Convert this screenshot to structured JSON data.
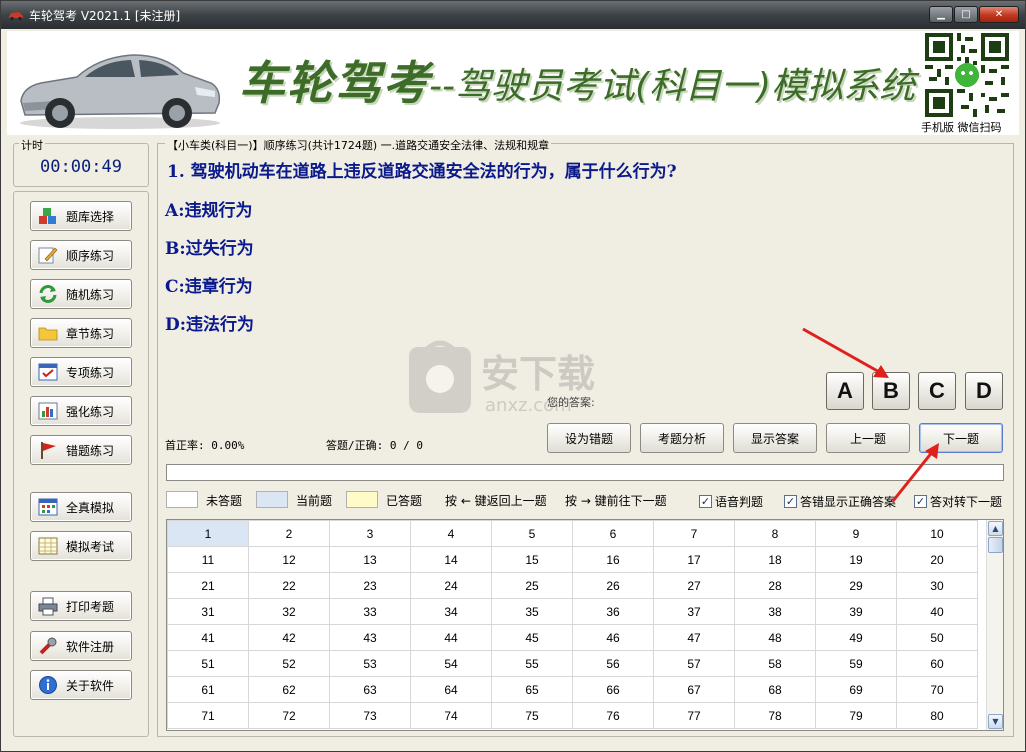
{
  "window": {
    "title": "车轮驾考 V2021.1 [未注册]",
    "controls": {
      "minimize": "▁",
      "maximize": "□",
      "close": "✕"
    }
  },
  "header": {
    "brand": "车轮驾考",
    "subtitle": "--驾驶员考试(科目一)模拟系统",
    "qr_caption": "手机版 微信扫码"
  },
  "timer": {
    "label": "计时",
    "value": "00:00:49"
  },
  "nav": {
    "items": [
      {
        "label": "题库选择",
        "icon": "cubes-icon"
      },
      {
        "label": "顺序练习",
        "icon": "pencil-note-icon"
      },
      {
        "label": "随机练习",
        "icon": "refresh-arrows-icon"
      },
      {
        "label": "章节练习",
        "icon": "folder-icon"
      },
      {
        "label": "专项练习",
        "icon": "checklist-icon"
      },
      {
        "label": "强化练习",
        "icon": "bar-chart-icon"
      },
      {
        "label": "错题练习",
        "icon": "red-flag-icon"
      },
      {
        "label": "全真模拟",
        "icon": "calendar-grid-icon"
      },
      {
        "label": "模拟考试",
        "icon": "table-icon"
      },
      {
        "label": "打印考题",
        "icon": "printer-icon"
      },
      {
        "label": "软件注册",
        "icon": "wrench-icon"
      },
      {
        "label": "关于软件",
        "icon": "info-icon"
      }
    ]
  },
  "exam": {
    "breadcrumb": "【小车类(科目一)】顺序练习(共计1724题) 一.道路交通安全法律、法规和规章",
    "question": "1. 驾驶机动车在道路上违反道路交通安全法的行为，属于什么行为?",
    "options": [
      "A:违规行为",
      "B:过失行为",
      "C:违章行为",
      "D:违法行为"
    ],
    "watermark": {
      "text": "安下载",
      "sub": "anxz.com"
    },
    "answer_label": "您的答案:",
    "answer_buttons": [
      "A",
      "B",
      "C",
      "D"
    ],
    "first_correct_rate": "首正率: 0.00%",
    "answered_correct": "答题/正确: 0 / 0",
    "actions": [
      "设为错题",
      "考题分析",
      "显示答案",
      "上一题",
      "下一题"
    ]
  },
  "legend": {
    "unanswered": "未答题",
    "current": "当前题",
    "answered": "已答题",
    "hint_prev": "按 ← 键返回上一题",
    "hint_next": "按 → 键前往下一题",
    "checks": [
      {
        "label": "语音判题",
        "checked": true
      },
      {
        "label": "答错显示正确答案",
        "checked": true
      },
      {
        "label": "答对转下一题",
        "checked": true
      }
    ]
  },
  "grid": {
    "rows": [
      [
        "1",
        "2",
        "3",
        "4",
        "5",
        "6",
        "7",
        "8",
        "9",
        "10"
      ],
      [
        "11",
        "12",
        "13",
        "14",
        "15",
        "16",
        "17",
        "18",
        "19",
        "20"
      ],
      [
        "21",
        "22",
        "23",
        "24",
        "25",
        "26",
        "27",
        "28",
        "29",
        "30"
      ],
      [
        "31",
        "32",
        "33",
        "34",
        "35",
        "36",
        "37",
        "38",
        "39",
        "40"
      ],
      [
        "41",
        "42",
        "43",
        "44",
        "45",
        "46",
        "47",
        "48",
        "49",
        "50"
      ],
      [
        "51",
        "52",
        "53",
        "54",
        "55",
        "56",
        "57",
        "58",
        "59",
        "60"
      ],
      [
        "61",
        "62",
        "63",
        "64",
        "65",
        "66",
        "67",
        "68",
        "69",
        "70"
      ],
      [
        "71",
        "72",
        "73",
        "74",
        "75",
        "76",
        "77",
        "78",
        "79",
        "80"
      ]
    ]
  },
  "colors": {
    "question_text": "#0a1a8c",
    "brand_green": "#3d6b28",
    "current_cell": "#dbe6f4",
    "answered_swatch": "#fffbc8",
    "annotation_red": "#e0201a"
  }
}
